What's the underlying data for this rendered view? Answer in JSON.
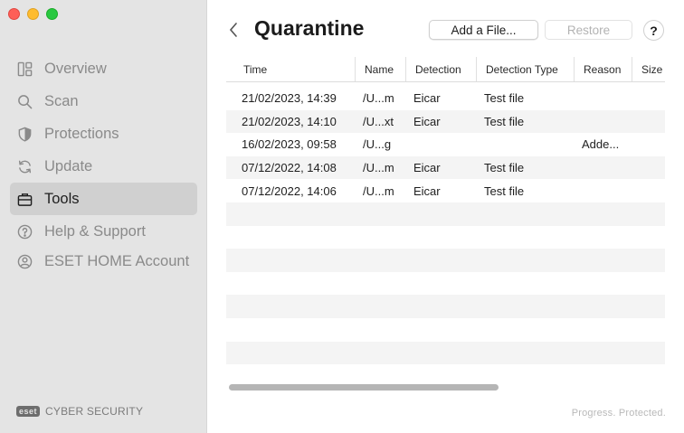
{
  "sidebar": {
    "items": [
      {
        "label": "Overview",
        "icon": "overview-icon"
      },
      {
        "label": "Scan",
        "icon": "search-icon"
      },
      {
        "label": "Protections",
        "icon": "shield-icon"
      },
      {
        "label": "Update",
        "icon": "refresh-icon"
      },
      {
        "label": "Tools",
        "icon": "briefcase-icon",
        "active": true
      },
      {
        "label": "Help & Support",
        "icon": "question-circle-icon"
      },
      {
        "label": "ESET HOME Account",
        "icon": "user-circle-icon"
      }
    ],
    "brand_logo": "eset",
    "brand_text": "CYBER SECURITY"
  },
  "header": {
    "title": "Quarantine",
    "add_file_label": "Add a File...",
    "restore_label": "Restore",
    "help_label": "?"
  },
  "table": {
    "columns": [
      "Time",
      "Name",
      "Detection",
      "Detection Type",
      "Reason",
      "Size"
    ],
    "rows": [
      {
        "time": "21/02/2023, 14:39",
        "name": "/U...m",
        "detection": "Eicar",
        "detection_type": "Test file",
        "reason": ""
      },
      {
        "time": "21/02/2023, 14:10",
        "name": "/U...xt",
        "detection": "Eicar",
        "detection_type": "Test file",
        "reason": ""
      },
      {
        "time": "16/02/2023, 09:58",
        "name": "/U...g",
        "detection": "",
        "detection_type": "",
        "reason": "Adde..."
      },
      {
        "time": "07/12/2022, 14:08",
        "name": "/U...m",
        "detection": "Eicar",
        "detection_type": "Test file",
        "reason": ""
      },
      {
        "time": "07/12/2022, 14:06",
        "name": "/U...m",
        "detection": "Eicar",
        "detection_type": "Test file",
        "reason": ""
      }
    ]
  },
  "footer": {
    "tagline": "Progress. Protected."
  },
  "colors": {
    "sidebar_bg": "#e4e4e4",
    "active_item_bg": "#d0d0d0",
    "row_alt": "#f4f4f4"
  }
}
